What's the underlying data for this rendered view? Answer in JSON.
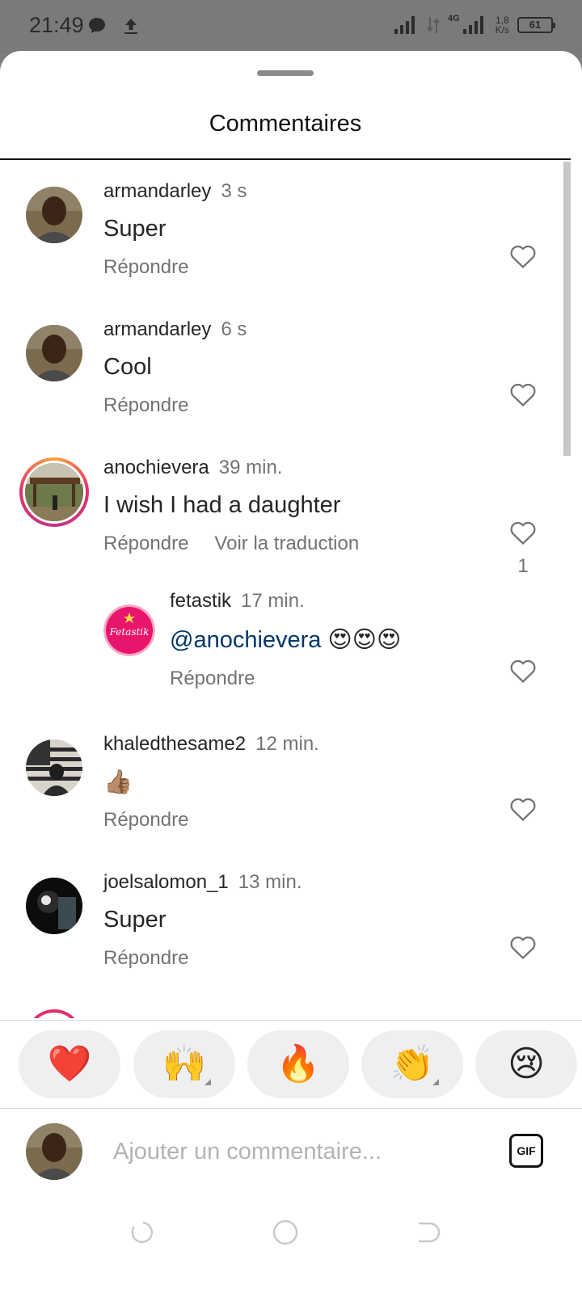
{
  "status_bar": {
    "time": "21:49",
    "net_type": "4G",
    "net_speed_value": "1,8",
    "net_speed_unit": "K/s",
    "battery": "61"
  },
  "sheet": {
    "title": "Commentaires"
  },
  "comments": [
    {
      "username": "armandarley",
      "time": "3 s",
      "text": "Super",
      "reply": "Répondre"
    },
    {
      "username": "armandarley",
      "time": "6 s",
      "text": "Cool",
      "reply": "Répondre"
    },
    {
      "username": "anochievera",
      "time": "39 min.",
      "text": "I wish I had a daughter",
      "reply": "Répondre",
      "translate": "Voir la traduction",
      "likes": "1"
    },
    {
      "username": "fetastik",
      "time": "17 min.",
      "mention": "@anochievera",
      "emoji": "😍😍😍",
      "reply": "Répondre",
      "avatar_text": "Fetastik"
    },
    {
      "username": "khaledthesame2",
      "time": "12 min.",
      "text": "👍🏽",
      "reply": "Répondre"
    },
    {
      "username": "joelsalomon_1",
      "time": "13 min.",
      "text": "Super",
      "reply": "Répondre"
    }
  ],
  "reactions": [
    "❤️",
    "🙌",
    "🔥",
    "👏",
    "😢"
  ],
  "composer": {
    "placeholder": "Ajouter un commentaire...",
    "gif_label": "GIF"
  },
  "colors": {
    "mention": "#00376b",
    "secondary_text": "#737373",
    "story_ring": "#e1306c"
  }
}
